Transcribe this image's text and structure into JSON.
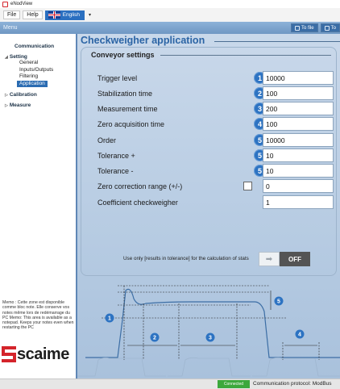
{
  "window": {
    "title": "eNodView"
  },
  "menubar": {
    "file": "File",
    "help": "Help",
    "language": "English"
  },
  "header": {
    "menu_label": "Menu",
    "to_file": "To file",
    "to_device": "To"
  },
  "sidebar": {
    "communication": "Communication",
    "setting": "Setting",
    "setting_items": [
      "General",
      "Inputs/Outputs",
      "Filtering",
      "Application"
    ],
    "calibration": "Calibration",
    "measure": "Measure",
    "memo": "Memo : Cette zone est disponible comme bloc note. Elle conserve vos notes même lors de redémarrage du PC Memo: This area is available as a notepad. Keeps your notes even when restarting the PC",
    "brand": "scaime"
  },
  "main": {
    "title": "Checkweigher application",
    "panel_title": "Conveyor settings",
    "fields": [
      {
        "label": "Trigger level",
        "badge": "1",
        "value": "10000"
      },
      {
        "label": "Stabilization time",
        "badge": "2",
        "value": "100"
      },
      {
        "label": "Measurement time",
        "badge": "3",
        "value": "200"
      },
      {
        "label": "Zero acquisition time",
        "badge": "4",
        "value": "100"
      },
      {
        "label": "Order",
        "badge": "5",
        "value": "10000"
      },
      {
        "label": "Tolerance +",
        "badge": "5",
        "value": "10"
      },
      {
        "label": "Tolerance -",
        "badge": "5",
        "value": "10"
      }
    ],
    "zero_correction": {
      "label": "Zero correction range (+/-)",
      "checked": false,
      "value": "0"
    },
    "coefficient": {
      "label": "Coefficient checkweigher",
      "value": "1"
    },
    "stats": {
      "label": "Use only [results in tolerance] for the calculation of stats",
      "state": "OFF"
    },
    "diagram_badges": [
      "1",
      "2",
      "3",
      "4",
      "5"
    ],
    "accent_color": "#2d73c2"
  },
  "statusbar": {
    "connected": "Connected",
    "protocol": "Communication protocol: ModBus"
  }
}
